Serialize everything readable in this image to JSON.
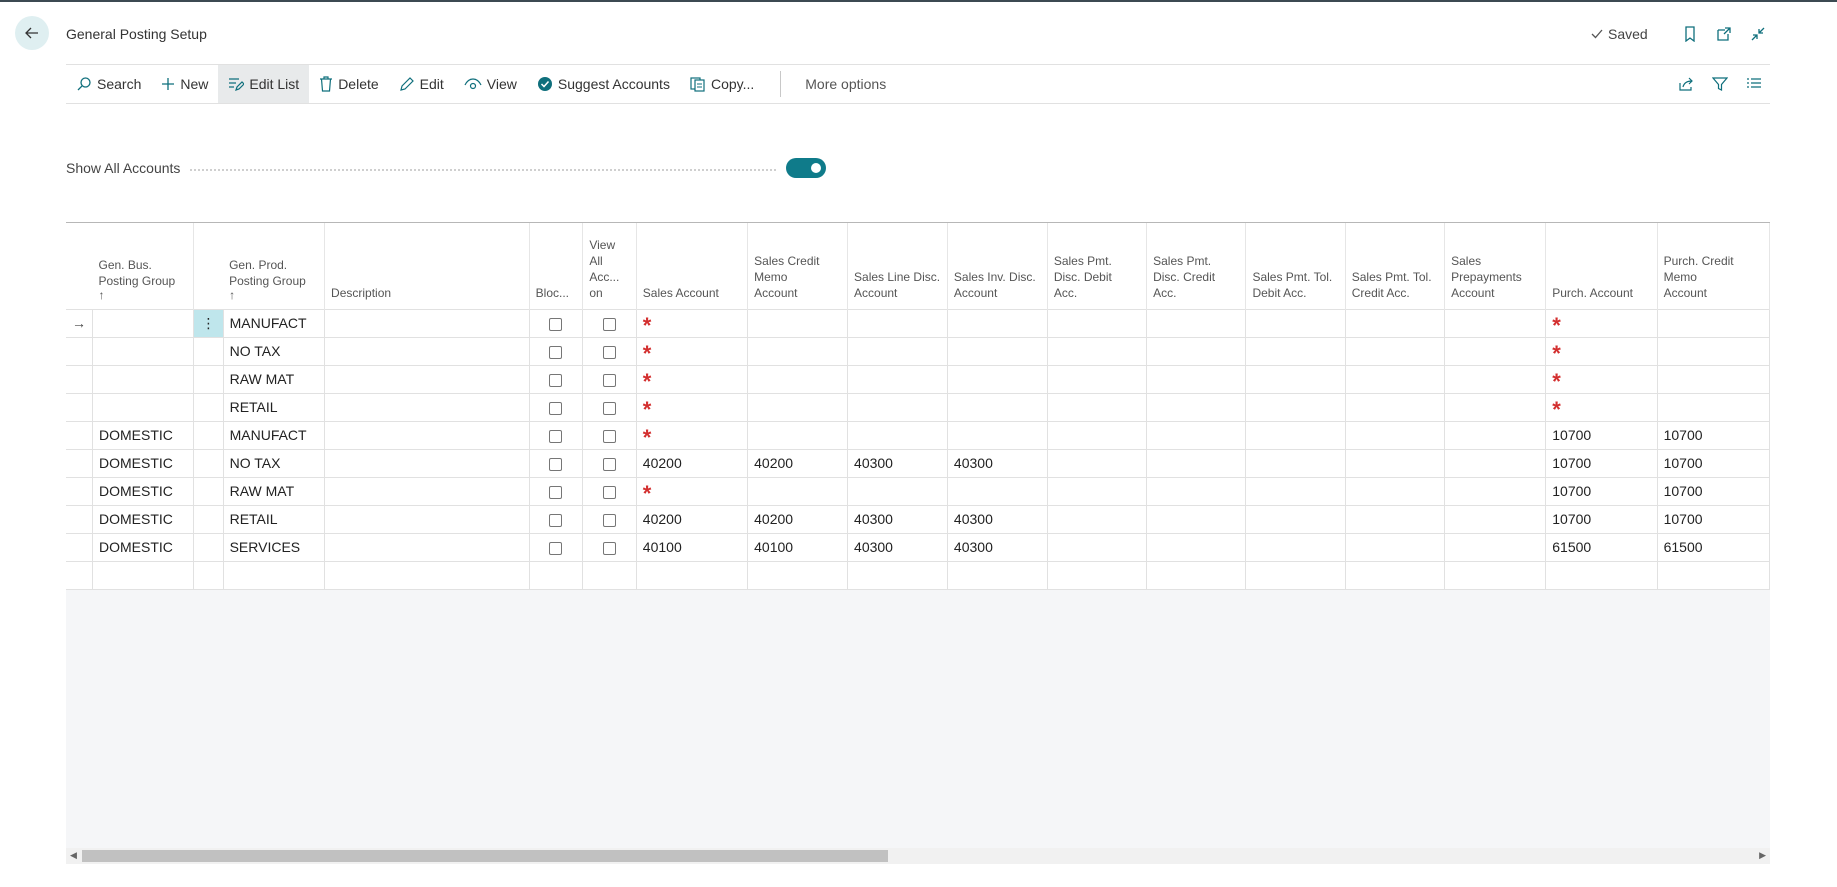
{
  "header": {
    "title": "General Posting Setup",
    "status": "Saved"
  },
  "toolbar": {
    "search": "Search",
    "new": "New",
    "edit_list": "Edit List",
    "delete": "Delete",
    "edit": "Edit",
    "view": "View",
    "suggest_accounts": "Suggest Accounts",
    "copy": "Copy...",
    "more_options": "More options"
  },
  "filter": {
    "label": "Show All Accounts",
    "enabled": true
  },
  "grid": {
    "columns": [
      {
        "key": "bus",
        "line1": "Gen. Bus.",
        "line2": "Posting Group"
      },
      {
        "key": "prod",
        "line1": "Gen. Prod.",
        "line2": "Posting Group"
      },
      {
        "key": "desc",
        "line1": "Description"
      },
      {
        "key": "blocked",
        "line1": "Bloc..."
      },
      {
        "key": "view_all",
        "line1": "View",
        "line2": "All",
        "line3": "Acc...",
        "line4": "on"
      },
      {
        "key": "sales",
        "line1": "Sales Account"
      },
      {
        "key": "sales_cm",
        "line1": "Sales Credit",
        "line2": "Memo",
        "line3": "Account"
      },
      {
        "key": "sales_line_disc",
        "line1": "Sales Line Disc.",
        "line2": "Account"
      },
      {
        "key": "sales_inv_disc",
        "line1": "Sales Inv. Disc.",
        "line2": "Account"
      },
      {
        "key": "sales_pmt_disc_debit",
        "line1": "Sales Pmt.",
        "line2": "Disc. Debit",
        "line3": "Acc."
      },
      {
        "key": "sales_pmt_disc_credit",
        "line1": "Sales Pmt.",
        "line2": "Disc. Credit",
        "line3": "Acc."
      },
      {
        "key": "sales_pmt_tol_debit",
        "line1": "Sales Pmt. Tol.",
        "line2": "Debit Acc."
      },
      {
        "key": "sales_pmt_tol_credit",
        "line1": "Sales Pmt. Tol.",
        "line2": "Credit Acc."
      },
      {
        "key": "sales_prepay",
        "line1": "Sales",
        "line2": "Prepayments",
        "line3": "Account"
      },
      {
        "key": "purch",
        "line1": "Purch. Account"
      },
      {
        "key": "purch_cm",
        "line1": "Purch. Credit",
        "line2": "Memo",
        "line3": "Account"
      }
    ],
    "rows": [
      {
        "bus": "",
        "prod": "MANUFACT",
        "sales": "*",
        "sales_cm": "",
        "sales_line_disc": "",
        "sales_inv_disc": "",
        "purch": "*",
        "purch_cm": ""
      },
      {
        "bus": "",
        "prod": "NO TAX",
        "sales": "*",
        "sales_cm": "",
        "sales_line_disc": "",
        "sales_inv_disc": "",
        "purch": "*",
        "purch_cm": ""
      },
      {
        "bus": "",
        "prod": "RAW MAT",
        "sales": "*",
        "sales_cm": "",
        "sales_line_disc": "",
        "sales_inv_disc": "",
        "purch": "*",
        "purch_cm": ""
      },
      {
        "bus": "",
        "prod": "RETAIL",
        "sales": "*",
        "sales_cm": "",
        "sales_line_disc": "",
        "sales_inv_disc": "",
        "purch": "*",
        "purch_cm": ""
      },
      {
        "bus": "DOMESTIC",
        "prod": "MANUFACT",
        "sales": "*",
        "sales_cm": "",
        "sales_line_disc": "",
        "sales_inv_disc": "",
        "purch": "10700",
        "purch_cm": "10700"
      },
      {
        "bus": "DOMESTIC",
        "prod": "NO TAX",
        "sales": "40200",
        "sales_cm": "40200",
        "sales_line_disc": "40300",
        "sales_inv_disc": "40300",
        "purch": "10700",
        "purch_cm": "10700"
      },
      {
        "bus": "DOMESTIC",
        "prod": "RAW MAT",
        "sales": "*",
        "sales_cm": "",
        "sales_line_disc": "",
        "sales_inv_disc": "",
        "purch": "10700",
        "purch_cm": "10700"
      },
      {
        "bus": "DOMESTIC",
        "prod": "RETAIL",
        "sales": "40200",
        "sales_cm": "40200",
        "sales_line_disc": "40300",
        "sales_inv_disc": "40300",
        "purch": "10700",
        "purch_cm": "10700"
      },
      {
        "bus": "DOMESTIC",
        "prod": "SERVICES",
        "sales": "40100",
        "sales_cm": "40100",
        "sales_line_disc": "40300",
        "sales_inv_disc": "40300",
        "purch": "61500",
        "purch_cm": "61500"
      }
    ]
  }
}
